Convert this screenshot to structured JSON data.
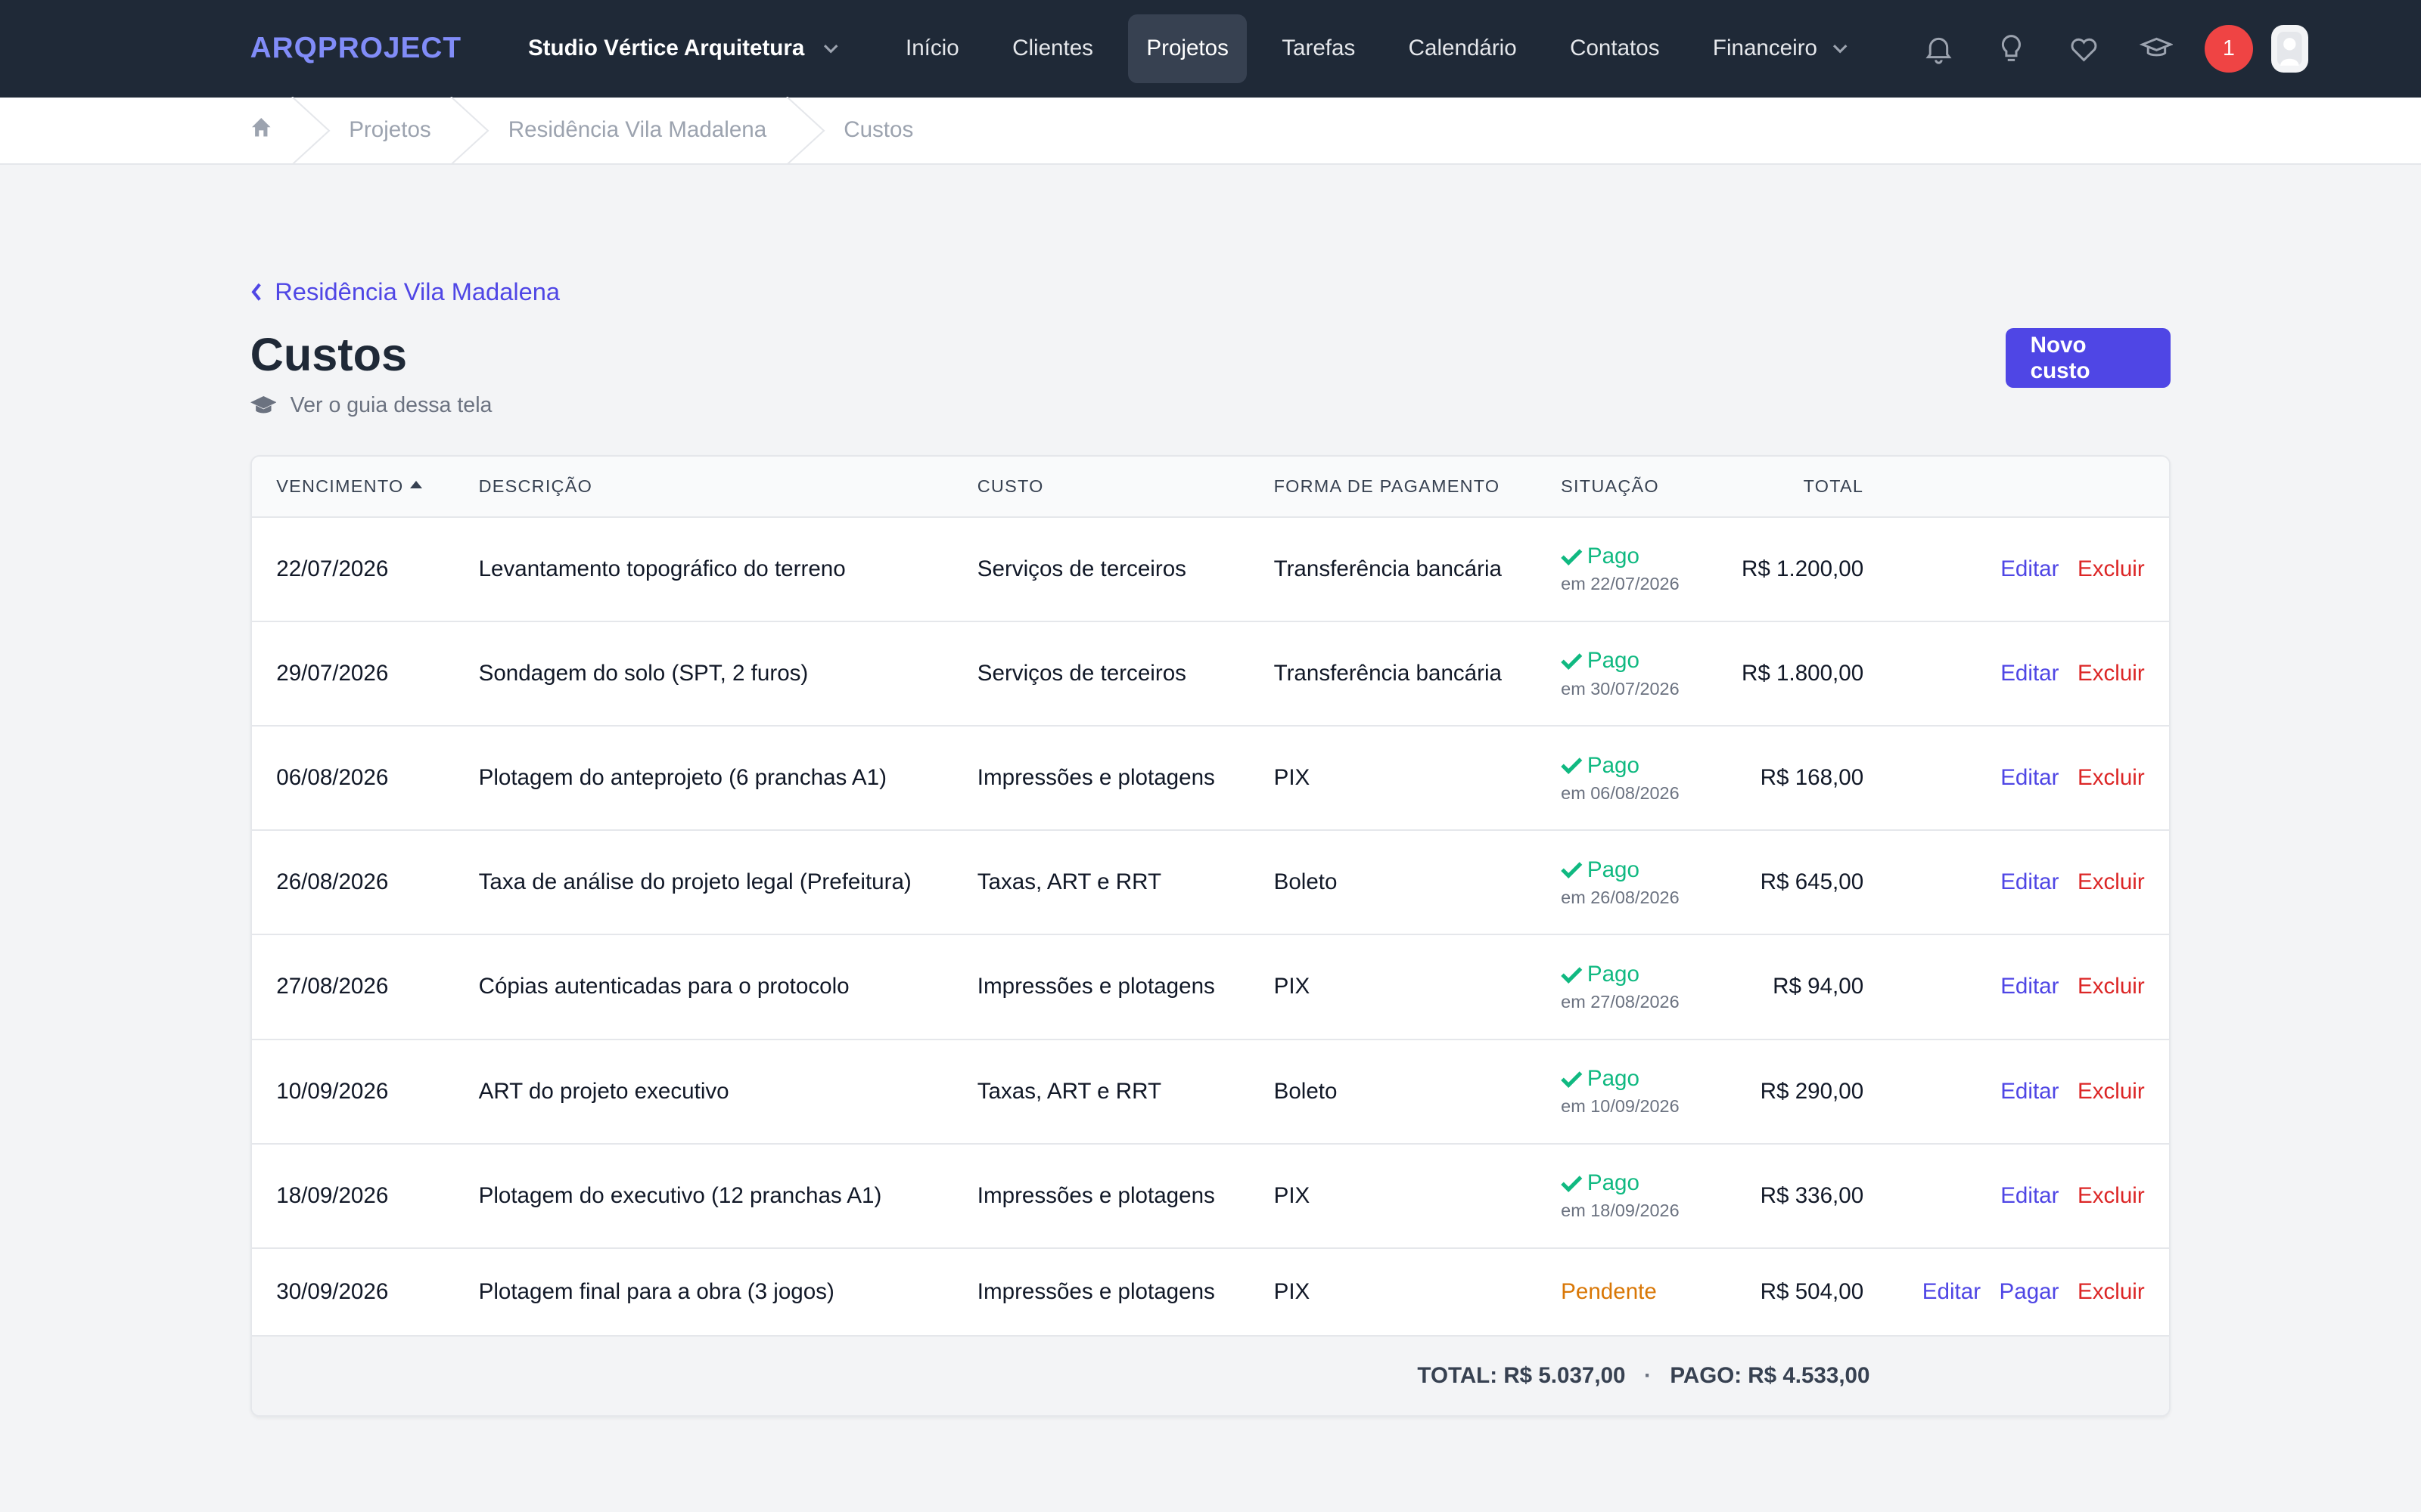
{
  "brand": {
    "logo_text": "ARQPROJECT",
    "accent": "#4f46e5"
  },
  "topnav": {
    "org_name": "Studio Vértice Arquitetura",
    "links": [
      {
        "label": "Início"
      },
      {
        "label": "Clientes"
      },
      {
        "label": "Projetos",
        "active": true
      },
      {
        "label": "Tarefas"
      },
      {
        "label": "Calendário"
      },
      {
        "label": "Contatos"
      },
      {
        "label": "Financeiro",
        "dropdown": true
      }
    ],
    "icons": [
      "bell-icon",
      "lightbulb-icon",
      "heart-icon",
      "graduation-cap-icon"
    ],
    "notification_count": "1"
  },
  "breadcrumb": {
    "items": [
      "Projetos",
      "Residência Vila Madalena",
      "Custos"
    ]
  },
  "page": {
    "back_link": "Residência Vila Madalena",
    "title": "Custos",
    "new_button": "Novo custo",
    "guide_link": "Ver o guia dessa tela"
  },
  "table": {
    "headers": {
      "vencimento": "VENCIMENTO",
      "descricao": "DESCRIÇÃO",
      "custo": "CUSTO",
      "forma": "FORMA DE PAGAMENTO",
      "situacao": "SITUAÇÃO",
      "total": "TOTAL"
    },
    "actions": {
      "edit": "Editar",
      "pay": "Pagar",
      "delete": "Excluir"
    },
    "rows": [
      {
        "vencimento": "22/07/2026",
        "descricao": "Levantamento topográfico do terreno",
        "custo": "Serviços de terceiros",
        "forma": "Transferência bancária",
        "status": "Pago",
        "status_date": "em 22/07/2026",
        "total": "R$ 1.200,00"
      },
      {
        "vencimento": "29/07/2026",
        "descricao": "Sondagem do solo (SPT, 2 furos)",
        "custo": "Serviços de terceiros",
        "forma": "Transferência bancária",
        "status": "Pago",
        "status_date": "em 30/07/2026",
        "total": "R$ 1.800,00"
      },
      {
        "vencimento": "06/08/2026",
        "descricao": "Plotagem do anteprojeto (6 pranchas A1)",
        "custo": "Impressões e plotagens",
        "forma": "PIX",
        "status": "Pago",
        "status_date": "em 06/08/2026",
        "total": "R$ 168,00"
      },
      {
        "vencimento": "26/08/2026",
        "descricao": "Taxa de análise do projeto legal (Prefeitura)",
        "custo": "Taxas, ART e RRT",
        "forma": "Boleto",
        "status": "Pago",
        "status_date": "em 26/08/2026",
        "total": "R$ 645,00"
      },
      {
        "vencimento": "27/08/2026",
        "descricao": "Cópias autenticadas para o protocolo",
        "custo": "Impressões e plotagens",
        "forma": "PIX",
        "status": "Pago",
        "status_date": "em 27/08/2026",
        "total": "R$ 94,00"
      },
      {
        "vencimento": "10/09/2026",
        "descricao": "ART do projeto executivo",
        "custo": "Taxas, ART e RRT",
        "forma": "Boleto",
        "status": "Pago",
        "status_date": "em 10/09/2026",
        "total": "R$ 290,00"
      },
      {
        "vencimento": "18/09/2026",
        "descricao": "Plotagem do executivo (12 pranchas A1)",
        "custo": "Impressões e plotagens",
        "forma": "PIX",
        "status": "Pago",
        "status_date": "em 18/09/2026",
        "total": "R$ 336,00"
      },
      {
        "vencimento": "30/09/2026",
        "descricao": "Plotagem final para a obra (3 jogos)",
        "custo": "Impressões e plotagens",
        "forma": "PIX",
        "status": "Pendente",
        "status_date": "",
        "total": "R$ 504,00"
      }
    ],
    "footer": {
      "total": "TOTAL: R$ 5.037,00",
      "separator": "·",
      "paid": "PAGO: R$ 4.533,00"
    }
  },
  "colors": {
    "paid": "#10b981",
    "pending": "#d97706",
    "delete": "#dc2626",
    "nav_bg": "#1f2937"
  }
}
